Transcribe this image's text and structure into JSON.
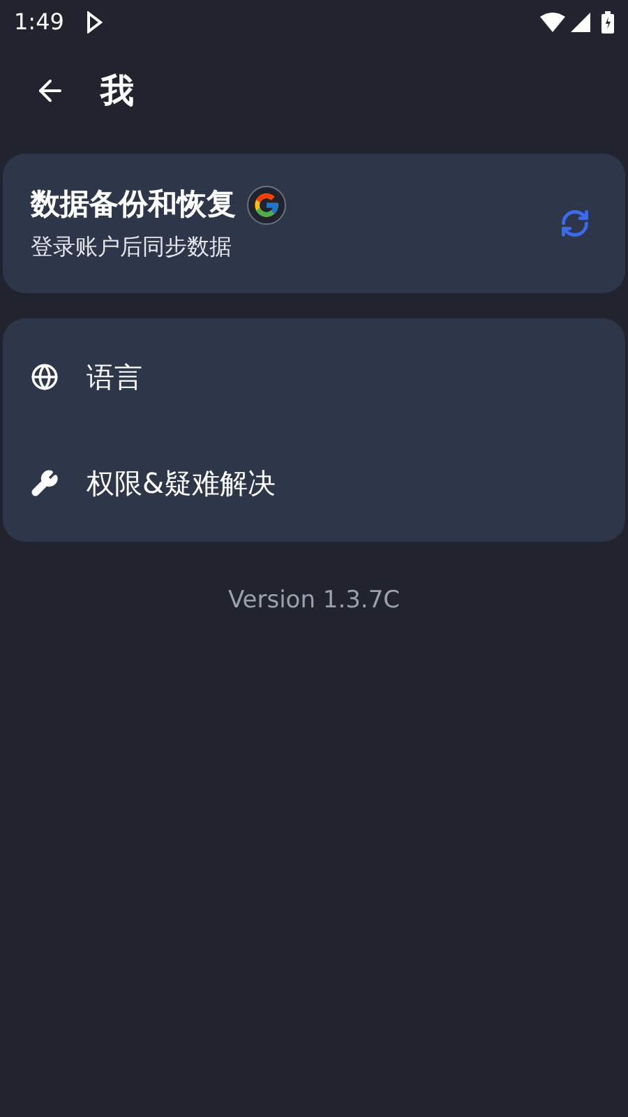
{
  "status_bar": {
    "time": "1:49"
  },
  "app_bar": {
    "title": "我"
  },
  "backup_card": {
    "title": "数据备份和恢复",
    "subtitle": "登录账户后同步数据"
  },
  "menu": [
    {
      "kind": "globe",
      "label": "语言"
    },
    {
      "kind": "wrench",
      "label": "权限&疑难解决"
    }
  ],
  "version": "Version 1.3.7C"
}
